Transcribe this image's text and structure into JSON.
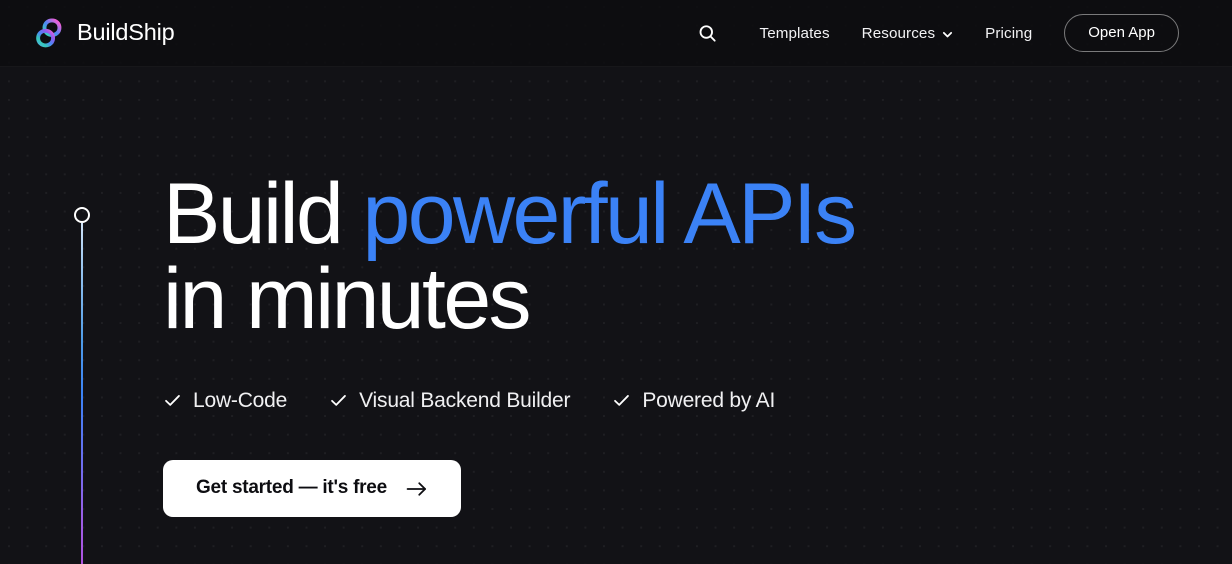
{
  "header": {
    "brand": {
      "name": "BuildShip",
      "logo_icon": "buildship-loop-logo-icon",
      "gradient_start": "#2fd1b5",
      "gradient_mid": "#5b7cf8",
      "gradient_end": "#e355d6"
    },
    "search_icon": "search-icon",
    "nav_links": [
      {
        "label": "Templates",
        "has_dropdown": false
      },
      {
        "label": "Resources",
        "has_dropdown": true,
        "dropdown_icon": "chevron-down-icon"
      },
      {
        "label": "Pricing",
        "has_dropdown": false
      }
    ],
    "cta_label": "Open App"
  },
  "hero": {
    "headline_line1_plain": "Build ",
    "headline_line1_accent": "powerful APIs",
    "headline_line2": "in minutes",
    "accent_color": "#3b82f6",
    "features": [
      {
        "label": "Low-Code",
        "icon": "check-icon"
      },
      {
        "label": "Visual Backend Builder",
        "icon": "check-icon"
      },
      {
        "label": "Powered by AI",
        "icon": "check-icon"
      }
    ],
    "cta_label": "Get started — it's free",
    "cta_arrow_icon": "arrow-right-icon"
  },
  "decor": {
    "rail_marker_icon": "timeline-dot-icon",
    "rail_gradient_top": "#cfe2f7",
    "rail_gradient_mid": "#3b82f6",
    "rail_gradient_bottom": "#b052e0",
    "background_color": "#121216",
    "dot_grid_color": "rgba(255,255,255,0.055)"
  }
}
